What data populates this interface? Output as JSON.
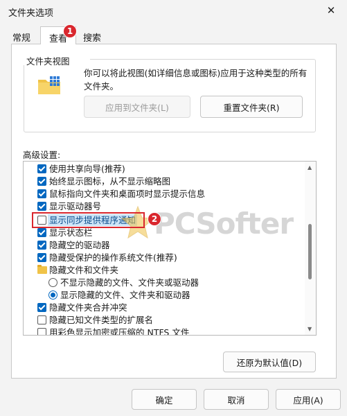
{
  "window": {
    "title": "文件夹选项",
    "close_glyph": "✕"
  },
  "tabs": [
    {
      "label": "常规",
      "selected": false
    },
    {
      "label": "查看",
      "selected": true
    },
    {
      "label": "搜索",
      "selected": false
    }
  ],
  "badges": {
    "one": "1",
    "two": "2"
  },
  "folder_views": {
    "group_label": "文件夹视图",
    "description": "你可以将此视图(如详细信息或图标)应用于这种类型的所有文件夹。",
    "apply_button": "应用到文件夹(L)",
    "reset_button": "重置文件夹(R)"
  },
  "advanced": {
    "label": "高级设置:",
    "items": [
      {
        "type": "checkbox",
        "checked": true,
        "label": "使用共享向导(推荐)"
      },
      {
        "type": "checkbox",
        "checked": true,
        "label": "始终显示图标，从不显示缩略图"
      },
      {
        "type": "checkbox",
        "checked": true,
        "label": "鼠标指向文件夹和桌面项时显示提示信息"
      },
      {
        "type": "checkbox",
        "checked": true,
        "label": "显示驱动器号"
      },
      {
        "type": "checkbox",
        "checked": false,
        "label": "显示同步提供程序通知"
      },
      {
        "type": "checkbox",
        "checked": true,
        "label": "显示状态栏"
      },
      {
        "type": "checkbox",
        "checked": true,
        "label": "隐藏空的驱动器"
      },
      {
        "type": "checkbox",
        "checked": true,
        "label": "隐藏受保护的操作系统文件(推荐)"
      },
      {
        "type": "folder",
        "label": "隐藏文件和文件夹"
      },
      {
        "type": "radio",
        "selected": false,
        "label": "不显示隐藏的文件、文件夹或驱动器"
      },
      {
        "type": "radio",
        "selected": true,
        "label": "显示隐藏的文件、文件夹和驱动器"
      },
      {
        "type": "checkbox",
        "checked": true,
        "label": "隐藏文件夹合并冲突"
      },
      {
        "type": "checkbox",
        "checked": false,
        "label": "隐藏已知文件类型的扩展名"
      },
      {
        "type": "checkbox",
        "checked": false,
        "label": "用彩色显示加密或压缩的 NTFS 文件"
      }
    ],
    "restore_button": "还原为默认值(D)"
  },
  "footer": {
    "ok": "确定",
    "cancel": "取消",
    "apply": "应用(A)"
  },
  "watermark": {
    "text": "PCSofter"
  },
  "colors": {
    "accent": "#0067c0",
    "badge": "#d9272e",
    "highlight_box": "#d9272e"
  }
}
